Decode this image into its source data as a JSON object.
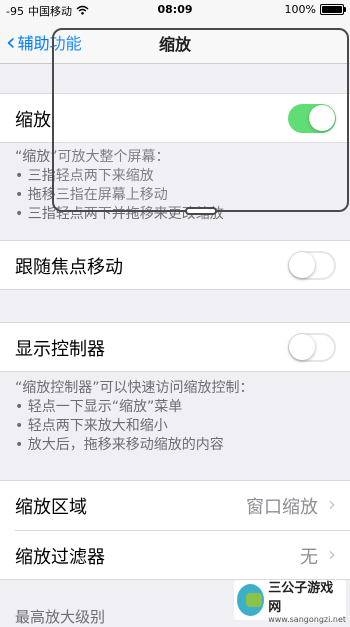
{
  "status_bar": {
    "signal": "-95",
    "carrier": "中国移动",
    "time": "08:09",
    "battery": "100%"
  },
  "nav": {
    "back_label": "辅助功能",
    "title": "缩放"
  },
  "zoom_toggle": {
    "label": "缩放",
    "state": "on"
  },
  "zoom_footer": [
    "“缩放”可放大整个屏幕：",
    "• 三指轻点两下来缩放",
    "• 拖移三指在屏幕上移动",
    "• 三指轻点两下并拖移来更改缩放"
  ],
  "follow_focus": {
    "label": "跟随焦点移动",
    "state": "off"
  },
  "show_controller": {
    "label": "显示控制器",
    "state": "off"
  },
  "controller_footer": [
    "“缩放控制器”可以快速访问缩放控制：",
    "• 轻点一下显示“缩放”菜单",
    "• 轻点两下来放大和缩小",
    "• 放大后，拖移来移动缩放的内容"
  ],
  "zoom_region": {
    "label": "缩放区域",
    "value": "窗口缩放"
  },
  "zoom_filter": {
    "label": "缩放过滤器",
    "value": "无"
  },
  "max_zoom_label": "最高放大级别",
  "watermark": {
    "name": "三公子游戏网",
    "url": "www.sangongzi.net"
  },
  "colors": {
    "accent": "#007aff",
    "toggle_on": "#4cd964",
    "background": "#efeff4"
  },
  "icons": [
    "wifi-icon",
    "battery-icon",
    "back-chevron-icon",
    "chevron-right-icon"
  ]
}
